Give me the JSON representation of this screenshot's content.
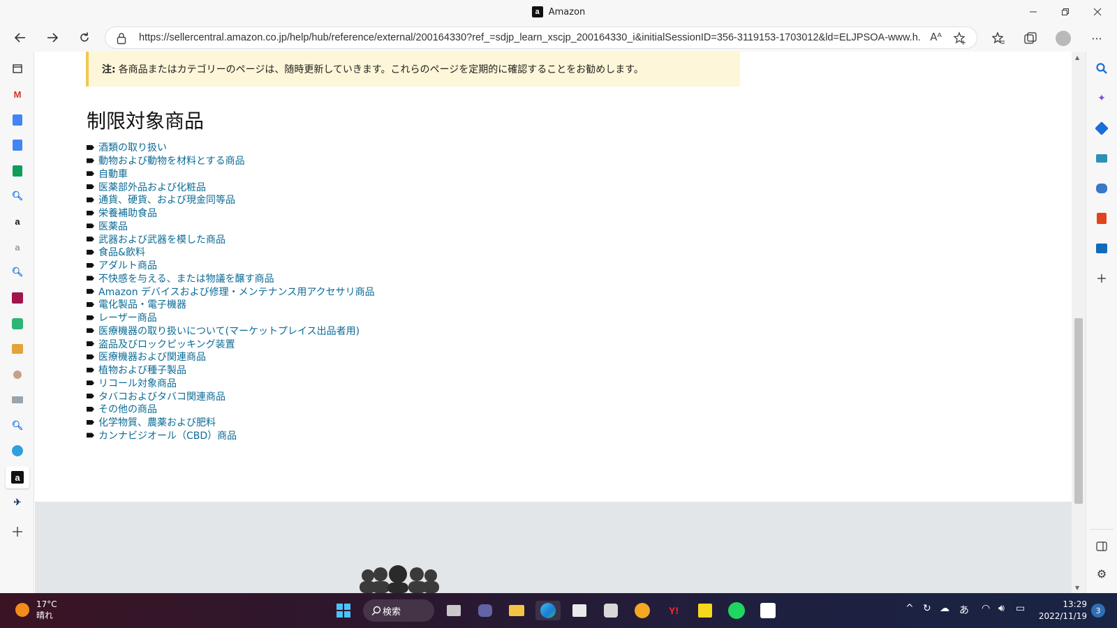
{
  "window": {
    "title": "Amazon",
    "minimize_icon": "minimize-icon",
    "restore_icon": "restore-icon",
    "close_icon": "close-icon"
  },
  "toolbar": {
    "url": "https://sellercentral.amazon.co.jp/help/hub/reference/external/200164330?ref_=sdjp_learn_xscjp_200164330_i&initialSessionID=356-3119153-1703012&ld=ELJPSOA-www.h..."
  },
  "note": {
    "label": "注:",
    "text": "各商品またはカテゴリーのページは、随時更新していきます。これらのページを定期的に確認することをお勧めします。"
  },
  "heading": "制限対象商品",
  "items": [
    "酒類の取り扱い",
    "動物および動物を材料とする商品",
    "自動車",
    "医薬部外品および化粧品",
    "通貨、硬貨、および現金同等品",
    "栄養補助食品",
    "医薬品",
    "武器および武器を模した商品",
    "食品&飲料",
    "アダルト商品",
    "不快感を与える、または物議を醸す商品",
    "Amazon デバイスおよび修理・メンテナンス用アクセサリ商品",
    "電化製品・電子機器",
    "レーザー商品",
    "医療機器の取り扱いについて(マーケットプレイス出品者用)",
    "盗品及びロックピッキング装置",
    "医療機器および関連商品",
    "植物および種子製品",
    "リコール対象商品",
    "タバコおよびタバコ関連商品",
    "その他の商品",
    "化学物質、農薬および肥料",
    "カンナビジオール（CBD）商品"
  ],
  "taskbar": {
    "temp": "17°C",
    "weather": "晴れ",
    "search_label": "検索",
    "ime": "あ",
    "time": "13:29",
    "date": "2022/11/19",
    "notifications": "3"
  },
  "leftbar_letters": {
    "amazon": "a"
  },
  "colors": {
    "link": "#0b6b96",
    "note_bg": "#fdf6d8",
    "footer_bg": "#e3e6e9"
  }
}
